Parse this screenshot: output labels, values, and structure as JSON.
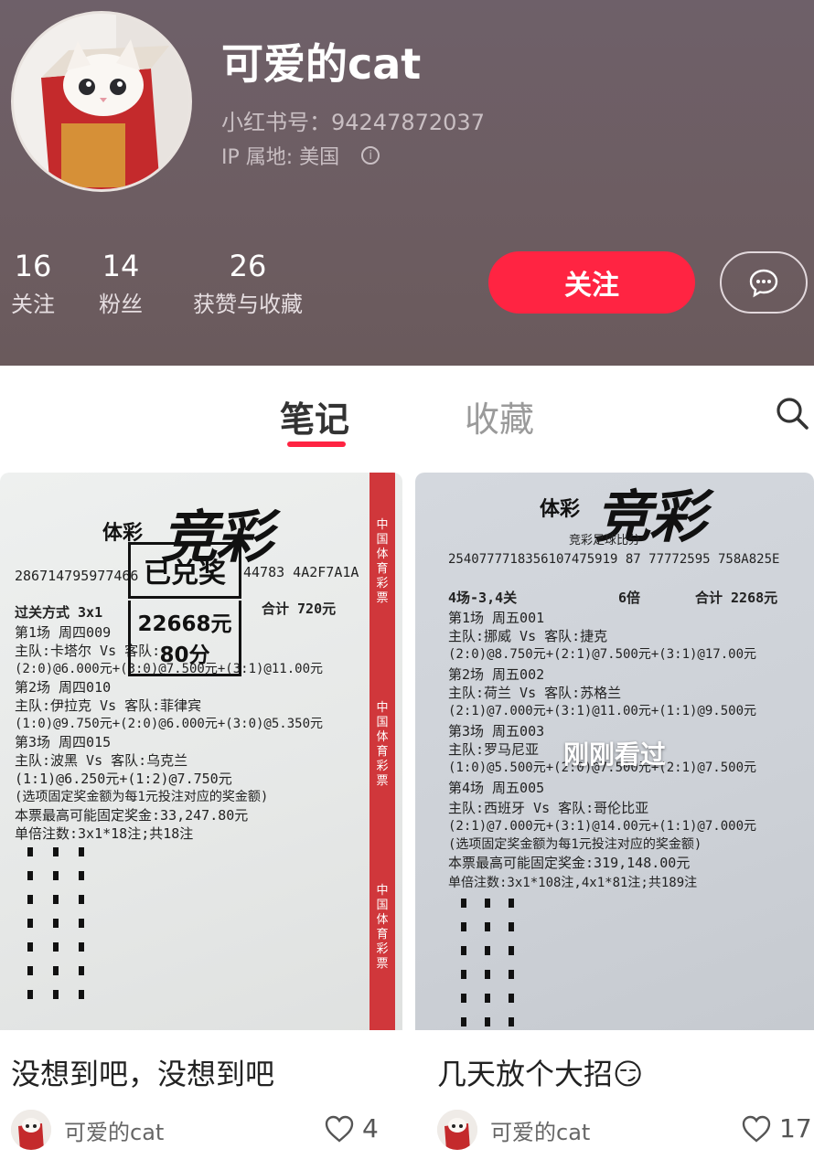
{
  "profile": {
    "nickname": "可爱的cat",
    "red_id": "小红书号：94247872037",
    "ip_location": "IP 属地: 美国",
    "avatar_icon": "cat-in-box-avatar",
    "brand_color": "#ff2442"
  },
  "stats": [
    {
      "value": "16",
      "label": "关注"
    },
    {
      "value": "14",
      "label": "粉丝"
    },
    {
      "value": "26",
      "label": "获赞与收藏"
    }
  ],
  "actions": {
    "follow_label": "关注",
    "message_icon": "chat-bubble-icon"
  },
  "tabs": [
    {
      "label": "笔记",
      "active": true
    },
    {
      "label": "收藏",
      "active": false
    }
  ],
  "search_icon": "search-icon",
  "notes": [
    {
      "title": "没想到吧，没想到吧",
      "author": "可爱的cat",
      "likes": "4",
      "ticket": {
        "brand_small": "体彩",
        "brand": "竞彩",
        "serial": "286714795977466",
        "serial_tail": "44783  4A2F7A1A",
        "stamp_line1": "已兑奖",
        "stamp_line2": "22668元80分",
        "lines": [
          "过关方式 3x1",
          "合计 720元",
          "第1场  周四009",
          "主队:卡塔尔 Vs 客队:",
          "(2:0)@6.000元+(3:0)@7.500元+(3:1)@11.00元",
          "第2场  周四010",
          "主队:伊拉克 Vs  客队:菲律宾",
          "(1:0)@9.750元+(2:0)@6.000元+(3:0)@5.350元",
          "第3场  周四015",
          "主队:波黑 Vs 客队:乌克兰",
          "(1:1)@6.250元+(1:2)@7.750元",
          "(选项固定奖金额为每1元投注对应的奖金额)",
          "本票最高可能固定奖金:33,247.80元",
          "单倍注数:3x1*18注;共18注"
        ],
        "strip_text": "中国体育彩票"
      }
    },
    {
      "title": "几天放个大招😏",
      "author": "可爱的cat",
      "likes": "17",
      "seen_label": "刚刚看过",
      "ticket": {
        "brand_small": "体彩",
        "brand": "竞彩",
        "subtitle": "竞彩足球比分",
        "serial": "2540777718356107475919 87  77772595  758A825E",
        "lines": [
          "4场-3,4关",
          "6倍",
          "合计 2268元",
          "第1场  周五001",
          "主队:挪威 Vs 客队:捷克",
          "(2:0)@8.750元+(2:1)@7.500元+(3:1)@17.00元",
          "第2场  周五002",
          "主队:荷兰 Vs 客队:苏格兰",
          "(2:1)@7.000元+(3:1)@11.00元+(1:1)@9.500元",
          "第3场  周五003",
          "主队:罗马尼亚",
          "(1:0)@5.500元+(2:0)@7.500元+(2:1)@7.500元",
          "第4场  周五005",
          "主队:西班牙 Vs 客队:哥伦比亚",
          "(2:1)@7.000元+(3:1)@14.00元+(1:1)@7.000元",
          "(选项固定奖金额为每1元投注对应的奖金额)",
          "本票最高可能固定奖金:319,148.00元",
          "单倍注数:3x1*108注,4x1*81注;共189注"
        ]
      }
    }
  ]
}
